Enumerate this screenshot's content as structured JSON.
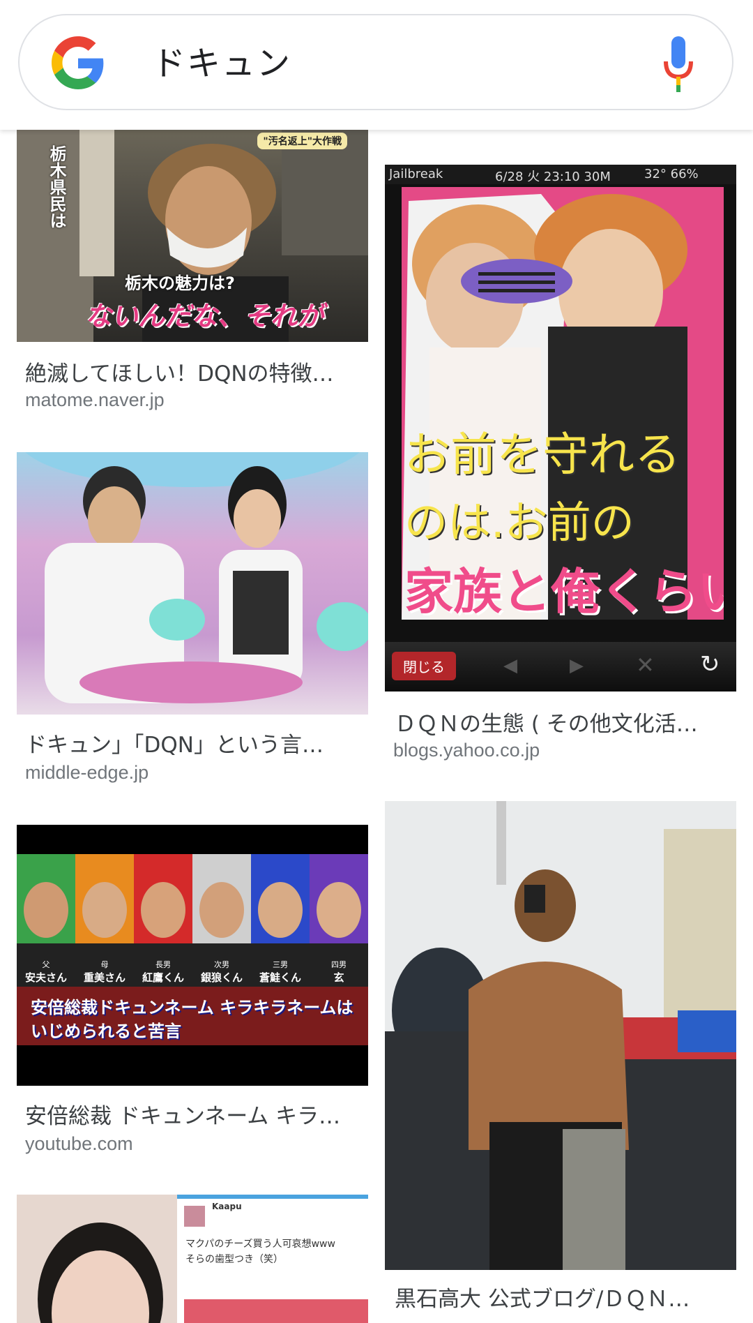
{
  "search": {
    "query": "ドキュン"
  },
  "icons": {
    "logo": "google-g-logo",
    "mic": "microphone-icon",
    "refresh": "refresh-icon"
  },
  "colors": {
    "google_blue": "#4285F4",
    "google_red": "#EA4335",
    "google_yellow": "#FBBC05",
    "google_green": "#34A853",
    "caption_text": "#3c4043",
    "domain_text": "#70757a"
  },
  "results": [
    {
      "caption": "絶滅してほしい！DQNの特徴…",
      "domain": "matome.naver.jp",
      "overlay": {
        "badge": "\"汚名返上\"大作戦",
        "vertical": "栃木県民は",
        "question": "栃木の魅力は?",
        "answer": "ないんだな、それが"
      }
    },
    {
      "caption": "ＤＱＮの生態 ( その他文化活…",
      "domain": "blogs.yahoo.co.jp",
      "overlay": {
        "status_left": "Jailbreak",
        "status_time": "6/28 火 23:10 30M",
        "status_right": "32° 66%",
        "line1": "お前を守れる",
        "line2": "のは.お前の",
        "line3": "家族と俺くらい",
        "close_button": "閉じる"
      }
    },
    {
      "caption": "ドキュン」「DQN」という言…",
      "domain": "middle-edge.jp"
    },
    {
      "caption": "安倍総裁 ドキュンネーム キラ…",
      "domain": "youtube.com",
      "overlay": {
        "members": [
          {
            "role": "父",
            "name": "安夫さん"
          },
          {
            "role": "母",
            "name": "重美さん"
          },
          {
            "role": "長男",
            "name": "紅鷹くん"
          },
          {
            "role": "次男",
            "name": "銀狼くん"
          },
          {
            "role": "三男",
            "name": "蒼鮭くん"
          },
          {
            "role": "四男",
            "name": "玄 "
          }
        ],
        "headline1": "安倍総裁ドキュンネーム キラキラネームは",
        "headline2": "いじめられると苦言"
      }
    },
    {
      "caption": "黒石高大 公式ブログ/ＤＱＮ…",
      "domain": "",
      "overlay": {}
    },
    {
      "caption": "",
      "domain": "",
      "overlay": {
        "tweet_user": "Kaapu",
        "tweet_text1": "マクパのチーズ買う人可哀想www",
        "tweet_text2": "そらの歯型つき（笑）"
      }
    }
  ]
}
